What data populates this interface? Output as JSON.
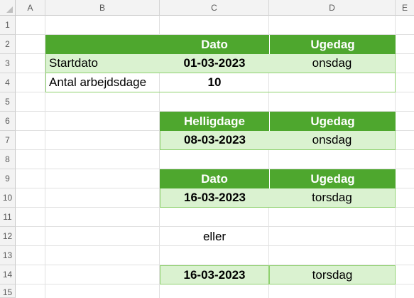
{
  "columns": [
    "A",
    "B",
    "C",
    "D",
    "E"
  ],
  "rows": [
    "1",
    "2",
    "3",
    "4",
    "5",
    "6",
    "7",
    "8",
    "9",
    "10",
    "11",
    "12",
    "13",
    "14",
    "15"
  ],
  "table1": {
    "header_dato": "Dato",
    "header_ugedag": "Ugedag",
    "startdato_label": "Startdato",
    "startdato_value": "01-03-2023",
    "startdato_weekday": "onsdag",
    "arbejdsdage_label": "Antal arbejdsdage",
    "arbejdsdage_value": "10"
  },
  "table2": {
    "header_helligdage": "Helligdage",
    "header_ugedag": "Ugedag",
    "date": "08-03-2023",
    "weekday": "onsdag"
  },
  "table3": {
    "header_dato": "Dato",
    "header_ugedag": "Ugedag",
    "date": "16-03-2023",
    "weekday": "torsdag"
  },
  "eller": "eller",
  "result2": {
    "date": "16-03-2023",
    "weekday": "torsdag"
  },
  "colors": {
    "header_green": "#4ea72e",
    "light_green": "#daf2d0",
    "border_green": "#8fd16f"
  }
}
